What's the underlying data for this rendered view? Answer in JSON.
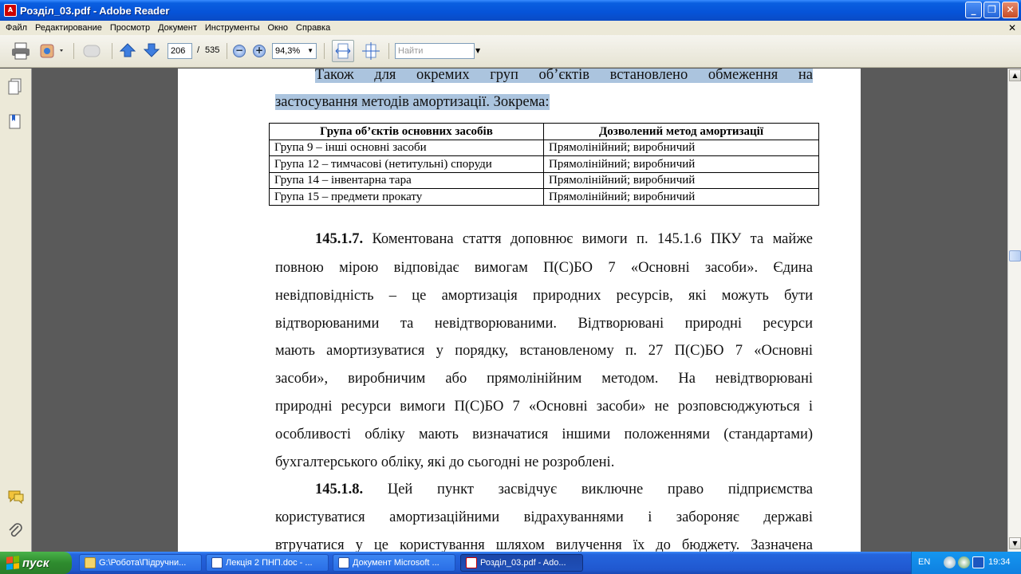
{
  "window": {
    "title": "Розділ_03.pdf - Adobe Reader",
    "app_icon": "adobe-reader-icon"
  },
  "menu": {
    "items": [
      "Файл",
      "Редактирование",
      "Просмотр",
      "Документ",
      "Инструменты",
      "Окно",
      "Справка"
    ]
  },
  "toolbar": {
    "page_current": "206",
    "page_separator": "/",
    "page_total": "535",
    "zoom": "94,3%",
    "search_placeholder": "Найти"
  },
  "document": {
    "intro_line1": "Також для окремих груп об’єктів встановлено обмеження на",
    "intro_line2": "застосування методів амортизації. Зокрема:",
    "table": {
      "headers": [
        "Група об’єктів основних засобів",
        "Дозволений метод амортизації"
      ],
      "rows": [
        [
          "Група 9 – інші основні засоби",
          "Прямолінійний; виробничий"
        ],
        [
          "Група 12 – тимчасові (нетитульні) споруди",
          "Прямолінійний; виробничий"
        ],
        [
          "Група 14 – інвентарна тара",
          "Прямолінійний; виробничий"
        ],
        [
          "Група 15 – предмети прокату",
          "Прямолінійний; виробничий"
        ]
      ]
    },
    "p1_num": "145.1.7.",
    "p1_lines": [
      "Коментована стаття доповнює вимоги п. 145.1.6 ПКУ та майже",
      "повною мірою відповідає вимогам П(С)БО 7 «Основні засоби». Єдина",
      "невідповідність – це амортизація природних ресурсів, які можуть бути",
      "відтворюваними та невідтворюваними. Відтворювані природні ресурси",
      "мають амортизуватися у порядку, встановленому п. 27 П(С)БО 7 «Основні",
      "засоби», виробничим або прямолінійним методом. На невідтворювані",
      "природні ресурси вимоги П(С)БО 7 «Основні засоби» не розповсюджуються і",
      "особливості обліку мають визначатися іншими положеннями (стандартами)",
      "бухгалтерського обліку, які до сьогодні не розроблені."
    ],
    "p2_num": "145.1.8.",
    "p2_lines": [
      "Цей пункт засвідчує виключне право підприємства",
      "користуватися амортизаційними відрахуваннями і забороняє державі",
      "втручатися у це користування шляхом вилучення їх до бюджету. Зазначена"
    ]
  },
  "taskbar": {
    "start_label": "пуск",
    "tasks": [
      "G:\\Робота\\Підручни...",
      "Лекція 2 ПНП.doc - ...",
      "Документ Microsoft ...",
      "Розділ_03.pdf - Ado..."
    ],
    "lang": "EN",
    "clock": "19:34"
  },
  "colors": {
    "titlebar": "#0653d8",
    "highlight": "#abc4de",
    "taskbar": "#2058d0",
    "start": "#2e8b2e"
  }
}
